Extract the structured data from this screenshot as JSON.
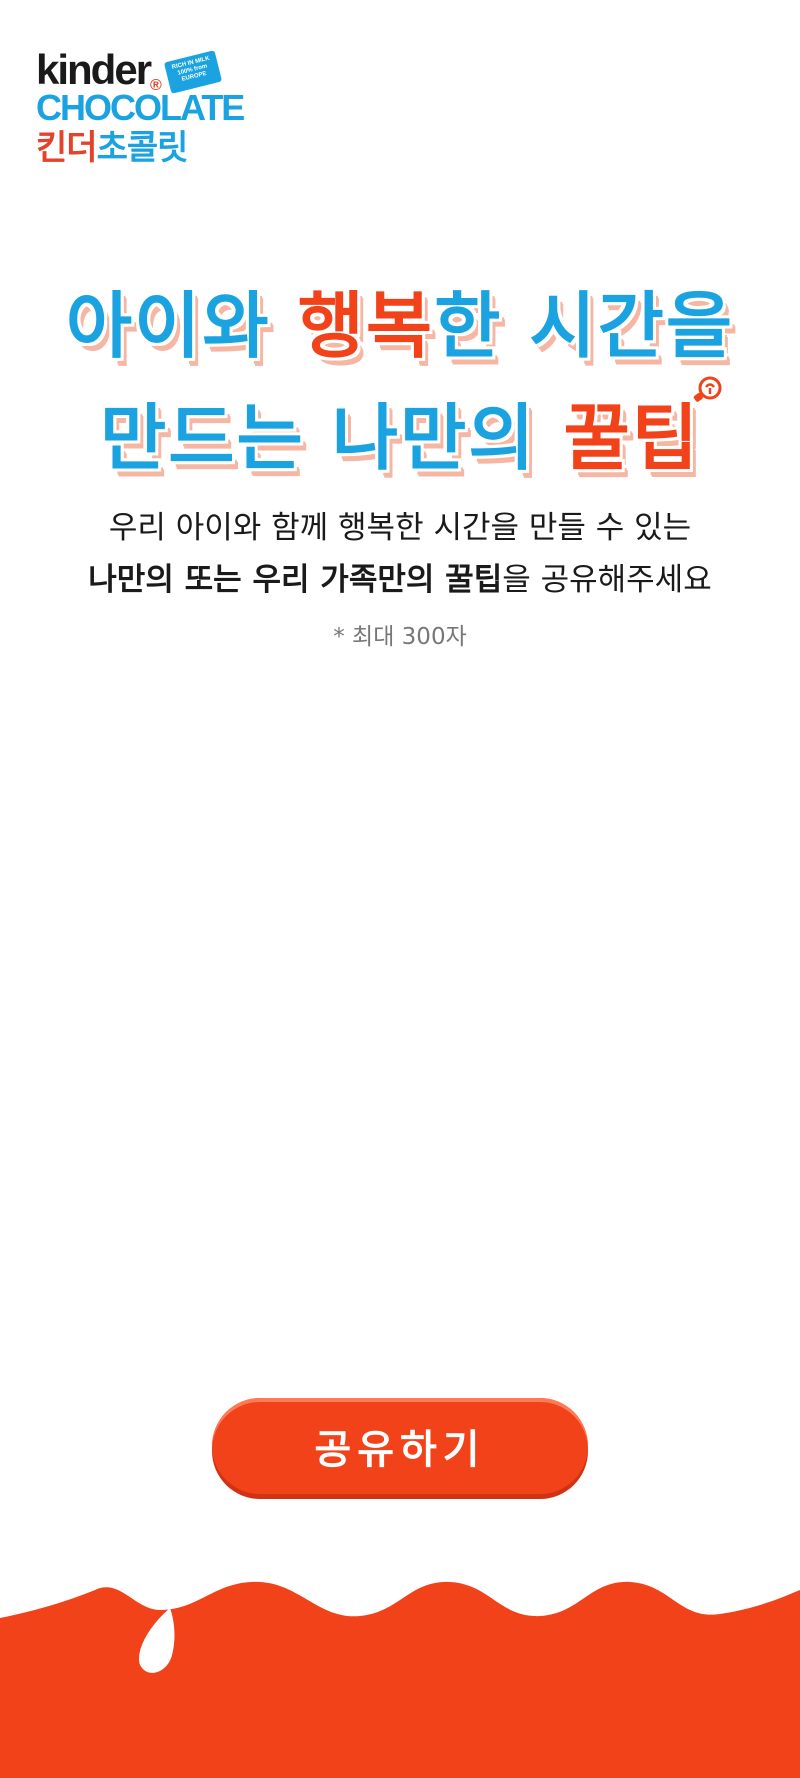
{
  "logo": {
    "brand": "kinder",
    "registered": "®",
    "badge_line1": "RICH IN MILK",
    "badge_line2": "100% from",
    "badge_line3": "EUROPE",
    "product": "CHOCOLATE",
    "korean_red": "킨더",
    "korean_blue": "초콜릿"
  },
  "headline": {
    "line1_part1": "아이와 ",
    "line1_highlight": "행복",
    "line1_part2": "한 시간을",
    "line2_part1": "만드는 나만의 ",
    "line2_highlight": "꿀팁"
  },
  "description": {
    "line1": "우리 아이와 함께 행복한 시간을 만들 수 있는",
    "line2_bold": "나만의 또는 우리 가족만의 꿀팁",
    "line2_rest": "을 공유해주세요"
  },
  "note": "* 최대 300자",
  "share_button": {
    "label": "공유하기"
  },
  "colors": {
    "accent_red": "#f2421a",
    "accent_blue": "#1ba3e1"
  }
}
